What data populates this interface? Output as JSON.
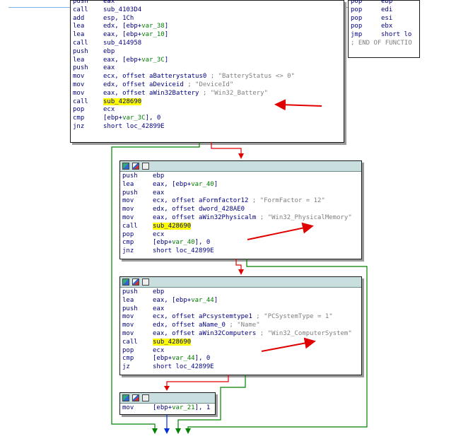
{
  "blocks": {
    "b1": {
      "rows": [
        {
          "op": "push",
          "a": "eax"
        },
        {
          "op": "call",
          "a": "sub_4103D4"
        },
        {
          "op": "add",
          "a": "esp, 1Ch"
        },
        {
          "op": "lea",
          "a": "edx, [ebp+var_38]"
        },
        {
          "op": "lea",
          "a": "eax, [ebp+var_10]"
        },
        {
          "op": "call",
          "a": "sub_414958"
        },
        {
          "op": "push",
          "a": "ebp"
        },
        {
          "op": "lea",
          "a": "eax, [ebp+var_3C]"
        },
        {
          "op": "push",
          "a": "eax"
        },
        {
          "op": "mov",
          "a": "ecx, offset aBatterystatus0 ; \"BatteryStatus <> 0\""
        },
        {
          "op": "mov",
          "a": "edx, offset aDeviceid ; \"DeviceId\""
        },
        {
          "op": "mov",
          "a": "eax, offset aWin32Battery ; \"Win32_Battery\""
        },
        {
          "op": "call",
          "a": "sub_428690"
        },
        {
          "op": "pop",
          "a": "ecx"
        },
        {
          "op": "cmp",
          "a": "[ebp+var_3C], 0"
        },
        {
          "op": "jnz",
          "a": "short loc_42899E"
        }
      ]
    },
    "b2": {
      "rows": [
        {
          "op": "pop",
          "a": "ebp"
        },
        {
          "op": "pop",
          "a": "edi"
        },
        {
          "op": "pop",
          "a": "esi"
        },
        {
          "op": "pop",
          "a": "ebx"
        },
        {
          "op": "jmp",
          "a": "short lo"
        },
        {
          "op": "",
          "a": "; END OF FUNCTIO"
        }
      ]
    },
    "b3": {
      "rows": [
        {
          "op": "push",
          "a": "ebp"
        },
        {
          "op": "lea",
          "a": "eax, [ebp+var_40]"
        },
        {
          "op": "push",
          "a": "eax"
        },
        {
          "op": "mov",
          "a": "ecx, offset aFormfactor12 ; \"FormFactor = 12\""
        },
        {
          "op": "mov",
          "a": "edx, offset dword_428AE0"
        },
        {
          "op": "mov",
          "a": "eax, offset aWin32Physicalm ; \"Win32_PhysicalMemory\""
        },
        {
          "op": "call",
          "a": "sub_428690"
        },
        {
          "op": "pop",
          "a": "ecx"
        },
        {
          "op": "cmp",
          "a": "[ebp+var_40], 0"
        },
        {
          "op": "jnz",
          "a": "short loc_42899E"
        }
      ]
    },
    "b4": {
      "rows": [
        {
          "op": "push",
          "a": "ebp"
        },
        {
          "op": "lea",
          "a": "eax, [ebp+var_44]"
        },
        {
          "op": "push",
          "a": "eax"
        },
        {
          "op": "mov",
          "a": "ecx, offset aPcsystemtype1 ; \"PCSystemType = 1\""
        },
        {
          "op": "mov",
          "a": "edx, offset aName_0 ; \"Name\""
        },
        {
          "op": "mov",
          "a": "eax, offset aWin32Computers ; \"Win32_ComputerSystem\""
        },
        {
          "op": "call",
          "a": "sub_428690"
        },
        {
          "op": "pop",
          "a": "ecx"
        },
        {
          "op": "cmp",
          "a": "[ebp+var_44], 0"
        },
        {
          "op": "jz",
          "a": "short loc_42899E"
        }
      ]
    },
    "b5": {
      "rows": [
        {
          "op": "mov",
          "a": "[ebp+var_21], 1"
        }
      ]
    }
  },
  "colors": {
    "text": "#000080",
    "var": "#008000",
    "comment": "#808080",
    "highlight": "#ffff00",
    "edge_true": "#008000",
    "edge_false": "#e00000",
    "edge_uncond": "#0030d0",
    "annotation": "#e00000"
  }
}
